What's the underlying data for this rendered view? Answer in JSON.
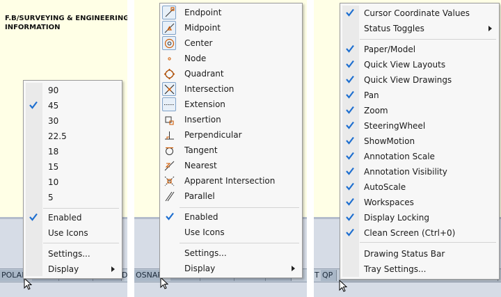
{
  "document": {
    "title_line1": "F.B/SURVEYING & ENGINEERING DESIGNING",
    "title_line2": "INFORMATION"
  },
  "panel1": {
    "status_button": "POLAR",
    "status_suffix": "D",
    "menu": {
      "angles": [
        {
          "label": "90",
          "checked": false
        },
        {
          "label": "45",
          "checked": true
        },
        {
          "label": "30",
          "checked": false
        },
        {
          "label": "22.5",
          "checked": false
        },
        {
          "label": "18",
          "checked": false
        },
        {
          "label": "15",
          "checked": false
        },
        {
          "label": "10",
          "checked": false
        },
        {
          "label": "5",
          "checked": false
        }
      ],
      "enabled": {
        "label": "Enabled",
        "checked": true
      },
      "use_icons": {
        "label": "Use Icons",
        "checked": false
      },
      "settings": "Settings...",
      "display": "Display"
    }
  },
  "panel2": {
    "status_button": "OSNAP",
    "menu": {
      "snaps": [
        {
          "label": "Endpoint",
          "icon": "endpoint-icon",
          "checked": true
        },
        {
          "label": "Midpoint",
          "icon": "midpoint-icon",
          "checked": true
        },
        {
          "label": "Center",
          "icon": "center-icon",
          "checked": true
        },
        {
          "label": "Node",
          "icon": "node-icon",
          "checked": false
        },
        {
          "label": "Quadrant",
          "icon": "quadrant-icon",
          "checked": false
        },
        {
          "label": "Intersection",
          "icon": "intersection-icon",
          "checked": true
        },
        {
          "label": "Extension",
          "icon": "extension-icon",
          "checked": true
        },
        {
          "label": "Insertion",
          "icon": "insertion-icon",
          "checked": false
        },
        {
          "label": "Perpendicular",
          "icon": "perpendicular-icon",
          "checked": false
        },
        {
          "label": "Tangent",
          "icon": "tangent-icon",
          "checked": false
        },
        {
          "label": "Nearest",
          "icon": "nearest-icon",
          "checked": false
        },
        {
          "label": "Apparent Intersection",
          "icon": "apparent-intersection-icon",
          "checked": false
        },
        {
          "label": "Parallel",
          "icon": "parallel-icon",
          "checked": false
        }
      ],
      "enabled": {
        "label": "Enabled",
        "checked": true
      },
      "use_icons": {
        "label": "Use Icons",
        "checked": false
      },
      "settings": "Settings...",
      "display": "Display"
    }
  },
  "panel3": {
    "status_t": "T",
    "status_button": "QP",
    "menu": {
      "cursor_coords": {
        "label": "Cursor Coordinate Values",
        "checked": true
      },
      "status_toggles": "Status Toggles",
      "items": [
        {
          "label": "Paper/Model",
          "checked": true
        },
        {
          "label": "Quick View Layouts",
          "checked": true
        },
        {
          "label": "Quick View Drawings",
          "checked": true
        },
        {
          "label": "Pan",
          "checked": true
        },
        {
          "label": "Zoom",
          "checked": true
        },
        {
          "label": "SteeringWheel",
          "checked": true
        },
        {
          "label": "ShowMotion",
          "checked": true
        },
        {
          "label": "Annotation Scale",
          "checked": true
        },
        {
          "label": "Annotation Visibility",
          "checked": true
        },
        {
          "label": "AutoScale",
          "checked": true
        },
        {
          "label": "Workspaces",
          "checked": true
        },
        {
          "label": "Display Locking",
          "checked": true
        },
        {
          "label": "Clean Screen (Ctrl+0)",
          "checked": true
        }
      ],
      "drawing_status_bar": "Drawing Status Bar",
      "tray_settings": "Tray Settings..."
    }
  },
  "colors": {
    "check": "#1e6fd0",
    "canvas": "#ffffe6",
    "statusbar": "#d6dce6"
  }
}
